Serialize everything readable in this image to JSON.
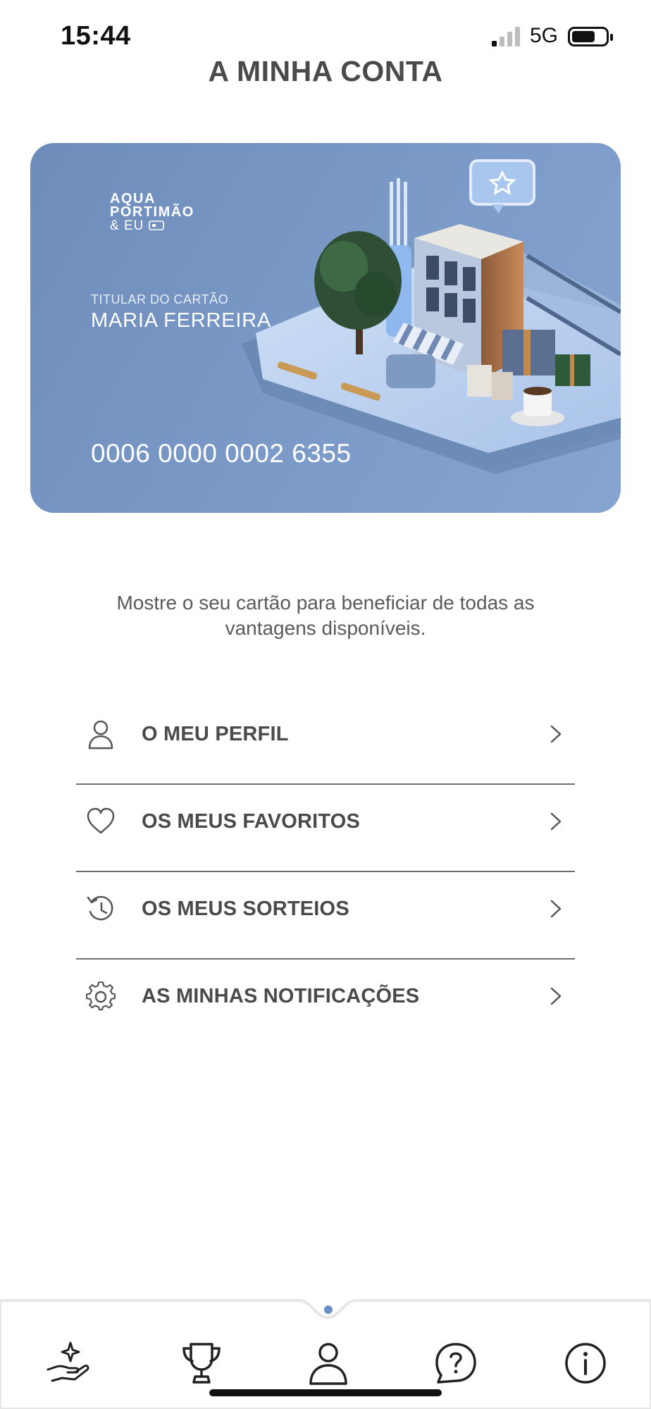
{
  "status_bar": {
    "time": "15:44",
    "network": "5G"
  },
  "header": {
    "title": "A MINHA CONTA"
  },
  "card": {
    "logo_lines": [
      "AQUA",
      "PORTIMÃO",
      "& EU"
    ],
    "holder_label": "TITULAR DO CARTÃO",
    "holder_name": "MARIA FERREIRA",
    "number": "0006 0000 0002 6355"
  },
  "card_hint": "Mostre o seu cartão para beneficiar de todas as vantagens disponíveis.",
  "menu": [
    {
      "label": "O MEU PERFIL",
      "icon": "user-icon"
    },
    {
      "label": "OS MEUS FAVORITOS",
      "icon": "heart-icon"
    },
    {
      "label": "OS MEUS SORTEIOS",
      "icon": "history-icon"
    },
    {
      "label": "AS MINHAS NOTIFICAÇÕES",
      "icon": "gear-icon"
    }
  ],
  "tabbar": {
    "tabs": [
      {
        "icon": "hand-sparkle-icon"
      },
      {
        "icon": "trophy-icon"
      },
      {
        "icon": "user-icon",
        "active": true
      },
      {
        "icon": "help-bubble-icon"
      },
      {
        "icon": "info-icon"
      }
    ],
    "active_color": "#6b8fc7"
  },
  "colors": {
    "card_background": "#7896c4",
    "text": "#4a4a4a",
    "divider": "#6e6e6e"
  }
}
